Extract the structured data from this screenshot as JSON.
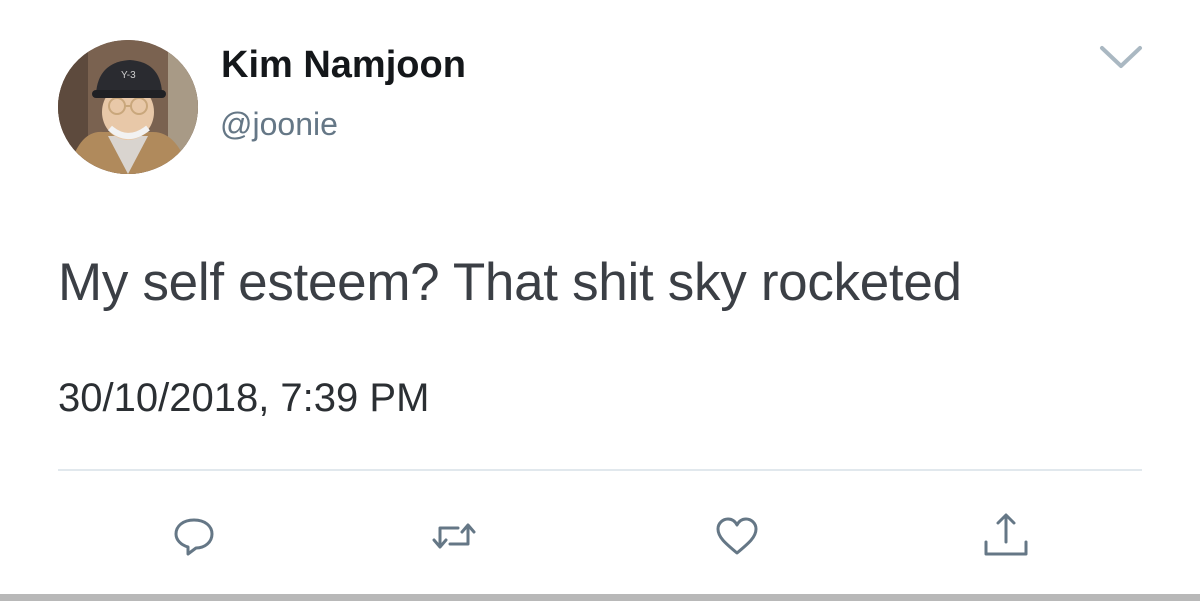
{
  "tweet": {
    "author": {
      "display_name": "Kim Namjoon",
      "handle": "@joonie",
      "avatar_icon": "profile-photo"
    },
    "text": "My self esteem? That shit sky rocketed",
    "timestamp": "30/10/2018, 7:39 PM",
    "menu_icon": "chevron-down-icon"
  },
  "actions": [
    {
      "name": "reply",
      "icon": "speech-bubble-icon"
    },
    {
      "name": "retweet",
      "icon": "retweet-arrows-icon"
    },
    {
      "name": "like",
      "icon": "heart-icon"
    },
    {
      "name": "share",
      "icon": "upload-arrow-icon"
    }
  ],
  "colors": {
    "text_primary": "#14171a",
    "text_secondary": "#657786",
    "icon": "#657786",
    "divider": "#e1e8ed"
  }
}
